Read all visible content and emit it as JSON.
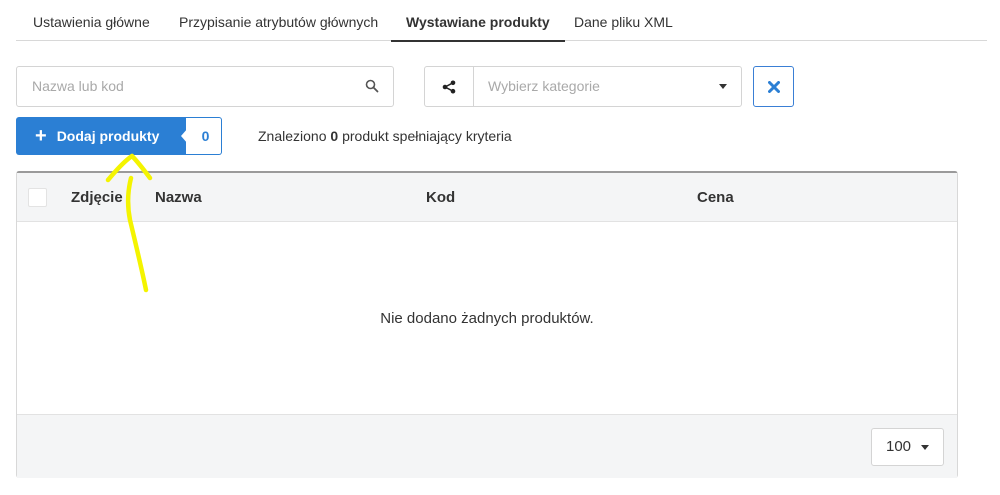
{
  "tabs": [
    {
      "label": "Ustawienia główne"
    },
    {
      "label": "Przypisanie atrybutów głównych"
    },
    {
      "label": "Wystawiane produkty"
    },
    {
      "label": "Dane pliku XML"
    }
  ],
  "search": {
    "placeholder": "Nazwa lub kod"
  },
  "category": {
    "placeholder": "Wybierz kategorie"
  },
  "add_button": {
    "label": "Dodaj produkty",
    "count": "0"
  },
  "found": {
    "prefix": "Znaleziono",
    "count": "0",
    "suffix": "produkt spełniający kryteria"
  },
  "table": {
    "columns": [
      "Zdjęcie",
      "Nazwa",
      "Kod",
      "Cena"
    ],
    "empty_message": "Nie dodano żadnych produktów."
  },
  "pagination": {
    "per_page": "100"
  },
  "colors": {
    "accent": "#2b7fd4",
    "highlight": "#f7f700"
  }
}
